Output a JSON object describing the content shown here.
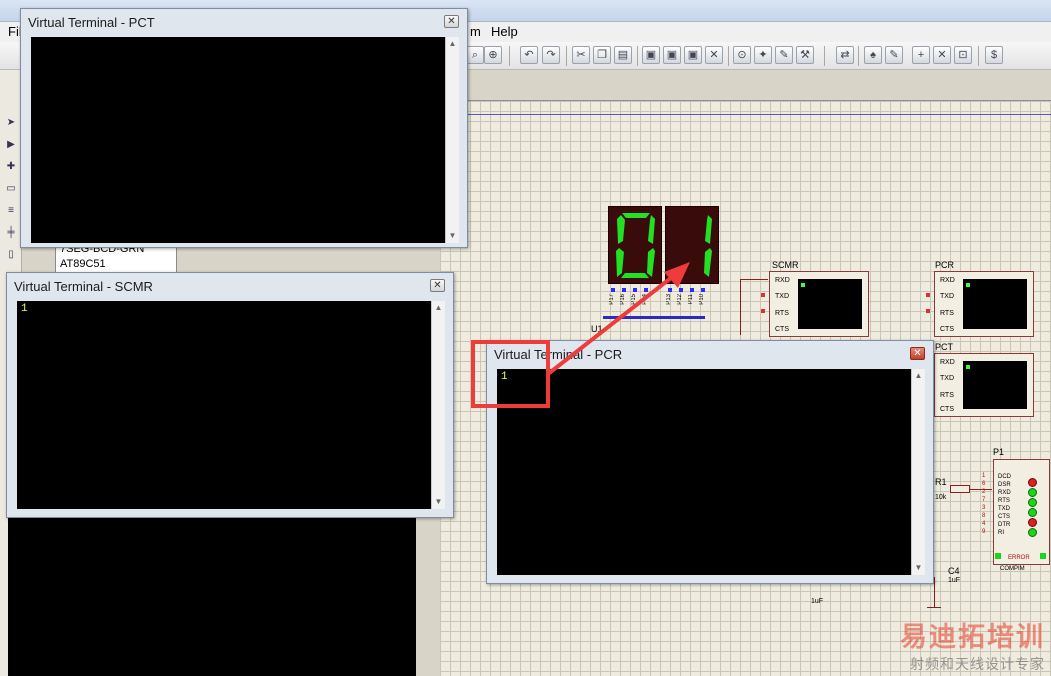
{
  "menu": {
    "file_fragment": "Fil",
    "help_fragment": "m",
    "help": "Help"
  },
  "device_list": {
    "item1": "7SEG-BCD-GRN",
    "item2": "AT89C51"
  },
  "windows": {
    "pct": {
      "title": "Virtual Terminal - PCT",
      "content": ""
    },
    "scmr": {
      "title": "Virtual Terminal - SCMR",
      "content": "1"
    },
    "pcr": {
      "title": "Virtual Terminal - PCR",
      "content": "1"
    }
  },
  "display": {
    "digits": [
      "0",
      "1"
    ],
    "pins": [
      "P17",
      "P16",
      "P15",
      "P14",
      "P13",
      "P12",
      "P11",
      "P10"
    ],
    "segment_color": "#22e022",
    "body_color": "#3a0b0b"
  },
  "schematic": {
    "u1_label": "U1",
    "scmr_label": "SCMR",
    "pcr_label": "PCR",
    "pct_label": "PCT",
    "terminal_pins": [
      "RXD",
      "TXD",
      "RTS",
      "CTS"
    ],
    "r1_label": "R1",
    "r1_value": "10k",
    "c4_label": "C4",
    "c4_value": "1uF",
    "c_value_lower": "1uF",
    "p1_label": "P1",
    "compim_pins": [
      "DCD",
      "DSR",
      "RXD",
      "RTS",
      "TXD",
      "CTS",
      "DTR",
      "RI"
    ],
    "compim_pin_numbers": [
      "1",
      "6",
      "2",
      "7",
      "3",
      "8",
      "4",
      "9"
    ],
    "compim_error": "ERROR",
    "compim_name": "COMPIM"
  },
  "annotation": {
    "color": "#ee3b3b"
  },
  "watermark": {
    "big": "易迪拓培训",
    "small": "射频和天线设计专家"
  }
}
